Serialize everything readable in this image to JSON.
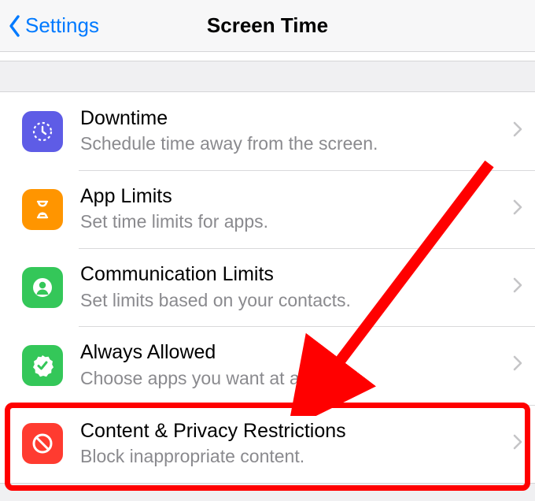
{
  "header": {
    "back_label": "Settings",
    "title": "Screen Time"
  },
  "items": [
    {
      "label": "Downtime",
      "sub": "Schedule time away from the screen.",
      "icon": "downtime-icon"
    },
    {
      "label": "App Limits",
      "sub": "Set time limits for apps.",
      "icon": "hourglass-icon"
    },
    {
      "label": "Communication Limits",
      "sub": "Set limits based on your contacts.",
      "icon": "contact-icon"
    },
    {
      "label": "Always Allowed",
      "sub": "Choose apps you want at all times.",
      "icon": "check-badge-icon"
    },
    {
      "label": "Content & Privacy Restrictions",
      "sub": "Block inappropriate content.",
      "icon": "no-entry-icon"
    }
  ],
  "annotation": {
    "highlight_index": 4,
    "highlight_color": "#ff0000"
  }
}
